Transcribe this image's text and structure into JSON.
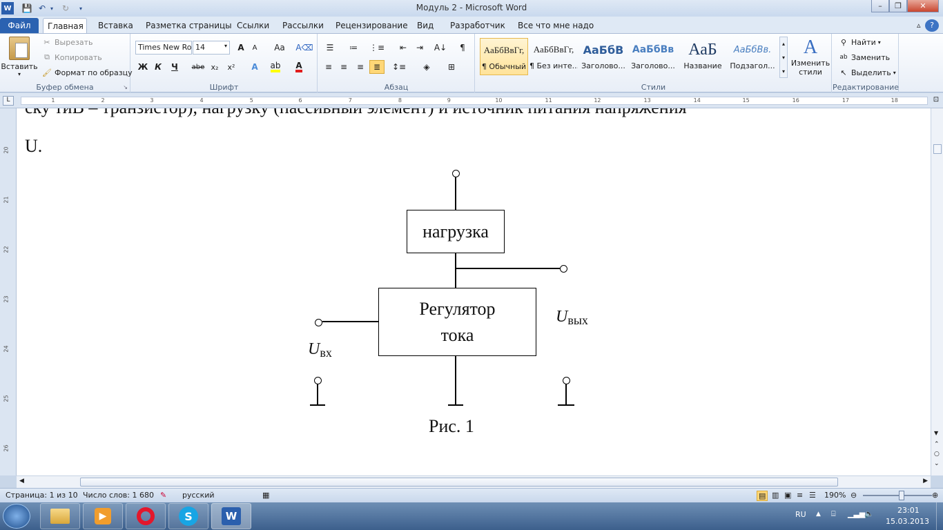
{
  "window": {
    "title": "Модуль 2  -  Microsoft Word"
  },
  "tabs": [
    "Файл",
    "Главная",
    "Вставка",
    "Разметка страницы",
    "Ссылки",
    "Рассылки",
    "Рецензирование",
    "Вид",
    "Разработчик",
    "Все что мне надо"
  ],
  "clipboard": {
    "paste": "Вставить",
    "cut": "Вырезать",
    "copy": "Копировать",
    "format_painter": "Формат по образцу",
    "label": "Буфер обмена"
  },
  "font": {
    "name": "Times New Ro",
    "size": "14",
    "bold": "Ж",
    "italic": "К",
    "underline": "Ч",
    "strike": "abe",
    "subscript": "x₂",
    "superscript": "x²",
    "grow": "A",
    "shrink": "A",
    "case": "Aa",
    "label": "Шрифт"
  },
  "paragraph": {
    "label": "Абзац",
    "pilcrow": "¶"
  },
  "styles": {
    "label": "Стили",
    "items": [
      {
        "preview": "АаБбВвГг,",
        "name": "¶ Обычный"
      },
      {
        "preview": "АаБбВвГг,",
        "name": "¶ Без инте..."
      },
      {
        "preview": "АаБбВ",
        "name": "Заголово..."
      },
      {
        "preview": "АаБбВв",
        "name": "Заголово..."
      },
      {
        "preview": "АаБ",
        "name": "Название"
      },
      {
        "preview": "АаБбВв.",
        "name": "Подзагол..."
      }
    ],
    "change_line1": "Изменить",
    "change_line2": "стили"
  },
  "editing": {
    "find": "Найти",
    "replace": "Заменить",
    "select": "Выделить",
    "label": "Редактирование"
  },
  "ruler": {
    "h": [
      "1",
      "2",
      "3",
      "4",
      "5",
      "6",
      "7",
      "8",
      "9",
      "10",
      "11",
      "12",
      "13",
      "14",
      "15",
      "16",
      "17",
      "18"
    ],
    "v": [
      "20",
      "21",
      "22",
      "23",
      "24",
      "25",
      "26"
    ]
  },
  "document": {
    "partial_line": "ску тиВ – транзистор), нагрузку (пассивный элемент) и источник питания напряжения",
    "line_u": "U.",
    "box_load": "нагрузка",
    "box_reg_1": "Регулятор",
    "box_reg_2": "тока",
    "u_in": "U",
    "u_in_sub": "вх",
    "u_out": "U",
    "u_out_sub": "вых",
    "caption": "Рис. 1"
  },
  "status": {
    "page": "Страница: 1 из 10",
    "words": "Число слов: 1 680",
    "lang": "русский",
    "zoom": "190%"
  },
  "taskbar": {
    "lang": "RU",
    "time": "23:01",
    "date": "15.03.2013"
  }
}
